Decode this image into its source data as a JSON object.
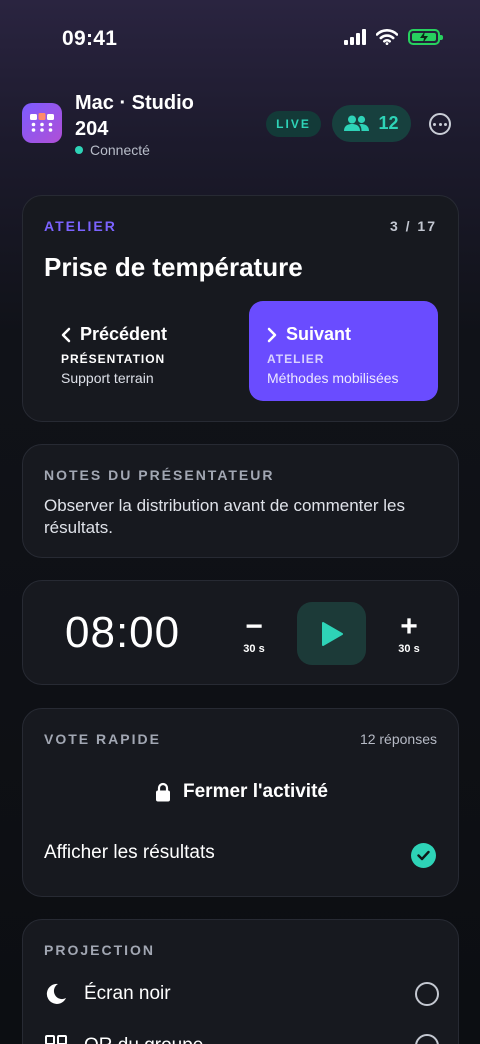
{
  "status_bar": {
    "time": "09:41"
  },
  "header": {
    "room_title": "Mac · Studio 204",
    "connection_status": "Connecté",
    "live_label": "LIVE",
    "participant_count": "12"
  },
  "activity": {
    "type_label": "ATELIER",
    "counter": "3 / 17",
    "title": "Prise de température",
    "previous": {
      "label": "Précédent",
      "kind": "PRÉSENTATION",
      "name": "Support terrain"
    },
    "next": {
      "label": "Suivant",
      "kind": "ATELIER",
      "name": "Méthodes mobilisées"
    }
  },
  "notes": {
    "label": "NOTES DU PRÉSENTATEUR",
    "text": "Observer la distribution avant de commenter les résultats."
  },
  "timer": {
    "value": "08:00",
    "minus_symbol": "−",
    "minus_amount": "30 s",
    "plus_symbol": "+",
    "plus_amount": "30 s"
  },
  "vote": {
    "label": "VOTE RAPIDE",
    "responses": "12 réponses",
    "close_label": "Fermer l'activité",
    "show_results_label": "Afficher les résultats",
    "show_results_checked": true
  },
  "projection": {
    "label": "PROJECTION",
    "options": [
      {
        "label": "Écran noir",
        "icon": "moon-icon",
        "selected": false
      },
      {
        "label": "QR du groupe",
        "icon": "qr-icon",
        "selected": false
      }
    ]
  },
  "colors": {
    "accent_purple": "#6a4cff",
    "accent_teal": "#2ed3b7",
    "battery_green": "#27d15f"
  }
}
